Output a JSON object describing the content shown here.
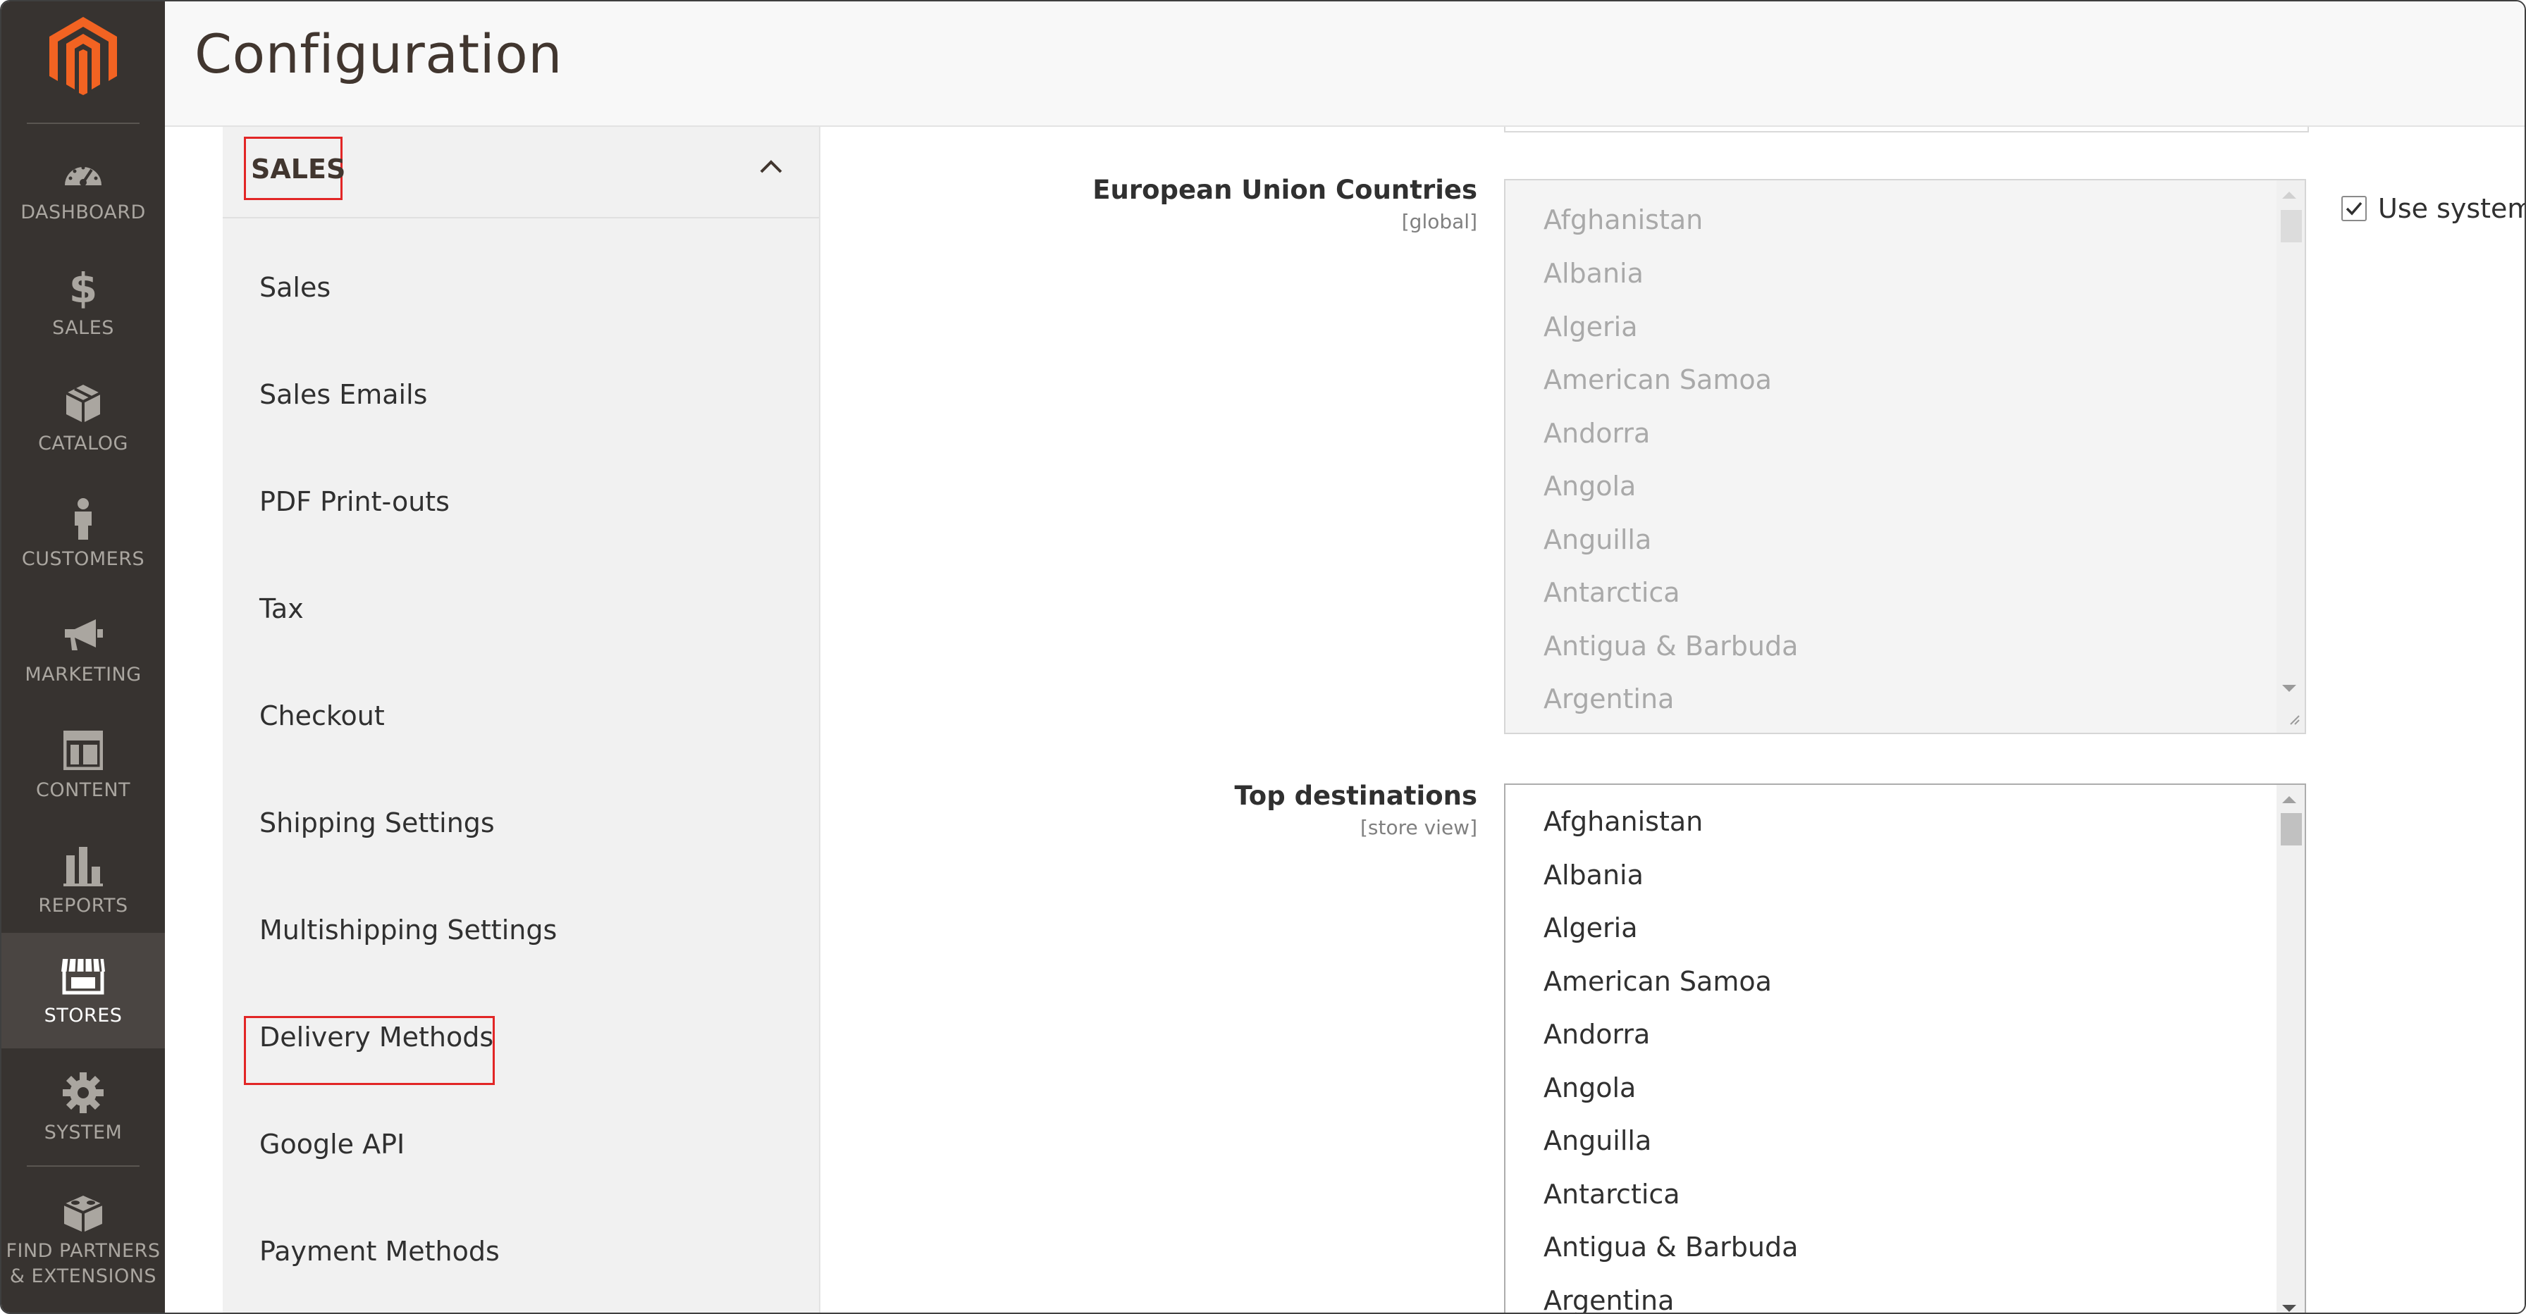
{
  "app": {
    "page_title": "Configuration"
  },
  "nav": {
    "items": [
      {
        "id": "dashboard",
        "label": "DASHBOARD",
        "icon": "dashboard-icon"
      },
      {
        "id": "sales",
        "label": "SALES",
        "icon": "dollar-icon"
      },
      {
        "id": "catalog",
        "label": "CATALOG",
        "icon": "box-icon"
      },
      {
        "id": "customers",
        "label": "CUSTOMERS",
        "icon": "person-icon"
      },
      {
        "id": "marketing",
        "label": "MARKETING",
        "icon": "megaphone-icon"
      },
      {
        "id": "content",
        "label": "CONTENT",
        "icon": "layout-icon"
      },
      {
        "id": "reports",
        "label": "REPORTS",
        "icon": "bar-chart-icon"
      },
      {
        "id": "stores",
        "label": "STORES",
        "icon": "storefront-icon",
        "active": true
      },
      {
        "id": "system",
        "label": "SYSTEM",
        "icon": "gear-icon"
      },
      {
        "id": "partners",
        "label_line1": "FIND PARTNERS",
        "label_line2": "& EXTENSIONS",
        "icon": "blocks-icon"
      }
    ],
    "colors": {
      "background": "#373330",
      "active": "#4a4542",
      "text": "#aaa6a0",
      "logo": "#f26322"
    }
  },
  "config_tabs": {
    "section_title": "SALES",
    "expanded": true,
    "links": [
      "Sales",
      "Sales Emails",
      "PDF Print-outs",
      "Tax",
      "Checkout",
      "Shipping Settings",
      "Multishipping Settings",
      "Delivery Methods",
      "Google API",
      "Payment Methods"
    ],
    "highlighted": [
      "SALES",
      "Delivery Methods"
    ],
    "highlight_color": "#e22626"
  },
  "fields": {
    "eu_countries": {
      "label": "European Union Countries",
      "scope": "[global]",
      "disabled": true,
      "options": [
        "Afghanistan",
        "Albania",
        "Algeria",
        "American Samoa",
        "Andorra",
        "Angola",
        "Anguilla",
        "Antarctica",
        "Antigua & Barbuda",
        "Argentina"
      ],
      "use_system_label": "Use system",
      "use_system_checked": true
    },
    "top_destinations": {
      "label": "Top destinations",
      "scope": "[store view]",
      "disabled": false,
      "options": [
        "Afghanistan",
        "Albania",
        "Algeria",
        "American Samoa",
        "Andorra",
        "Angola",
        "Anguilla",
        "Antarctica",
        "Antigua & Barbuda",
        "Argentina"
      ]
    }
  }
}
